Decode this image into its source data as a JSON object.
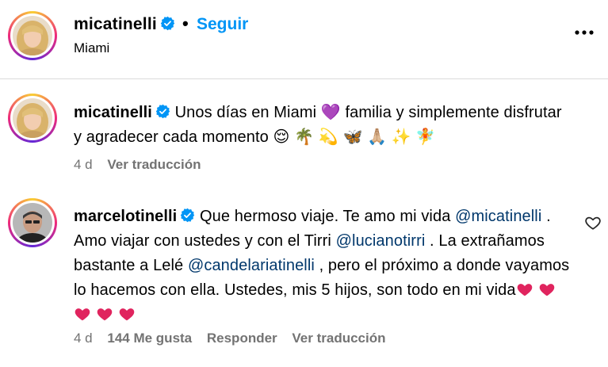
{
  "header": {
    "username": "micatinelli",
    "separator": "•",
    "follow_label": "Seguir",
    "location": "Miami"
  },
  "caption": {
    "username": "micatinelli",
    "text": "Unos días en Miami 💜 familia y simplemente disfrutar y agradecer cada momento 😌 🌴 💫 🦋 🙏🏼 ✨ 🧚",
    "time": "4 d",
    "translate_label": "Ver traducción"
  },
  "reply": {
    "username": "marcelotinelli",
    "text_1": "Que hermoso viaje. Te amo mi vida",
    "mention_1": "@micatinelli",
    "text_2": ". Amo viajar con ustedes y con el Tirri",
    "mention_2": "@lucianotirri",
    "text_3": ". La extrañamos bastante a Lelé",
    "mention_3": "@candelariatinelli",
    "text_4": ", pero el próximo a donde vayamos lo hacemos con ella. Ustedes, mis 5 hijos, son todo en mi vida",
    "time": "4 d",
    "likes": "144 Me gusta",
    "reply_label": "Responder",
    "translate_label": "Ver traducción",
    "hearts_count": 5
  },
  "colors": {
    "link_blue": "#0095f6",
    "mention_blue": "#00376b",
    "verified_blue": "#0095f6",
    "meta_gray": "#737373",
    "heart_red": "#e0245e"
  },
  "icons": [
    "verified-badge-icon",
    "more-options-icon",
    "heart-outline-icon",
    "red-heart-emoji"
  ]
}
